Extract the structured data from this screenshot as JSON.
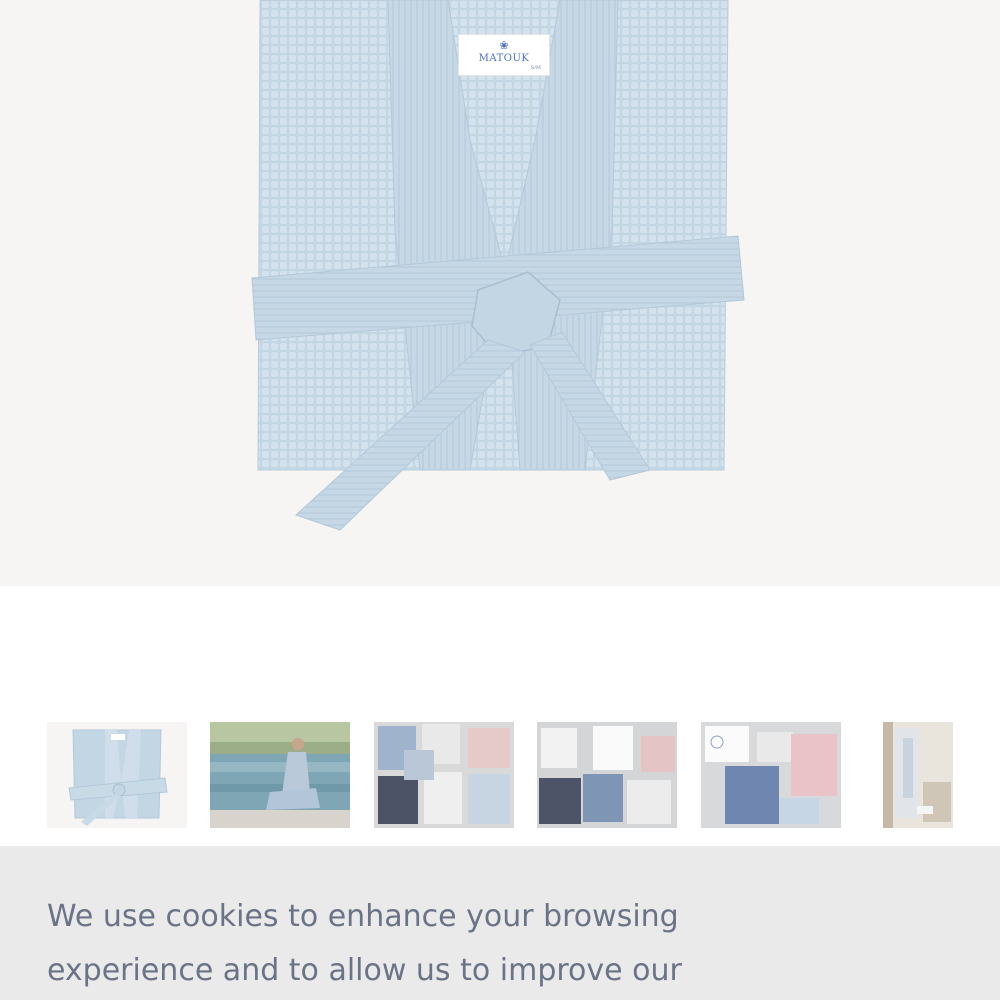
{
  "product_image": {
    "brand_label": "MATOUK",
    "brand_icon": "lotus-icon",
    "brand_sub": "S/M",
    "robe_color": "#c3d6e4",
    "background": "#f6f5f3"
  },
  "thumbnails": [
    {
      "name": "thumbnail-robe-folded",
      "kind": "folded-robe"
    },
    {
      "name": "thumbnail-woman-pool",
      "kind": "lifestyle-pool"
    },
    {
      "name": "thumbnail-robe-collection-1",
      "kind": "collection"
    },
    {
      "name": "thumbnail-robe-collection-2",
      "kind": "collection"
    },
    {
      "name": "thumbnail-robe-collection-3",
      "kind": "collection"
    },
    {
      "name": "thumbnail-robe-hanging",
      "kind": "hanging-robe"
    }
  ],
  "cookie_banner": {
    "text": "We use cookies to enhance your browsing experience and to allow us to improve our",
    "background": "#eaeaeb",
    "text_color": "#6b7386"
  }
}
